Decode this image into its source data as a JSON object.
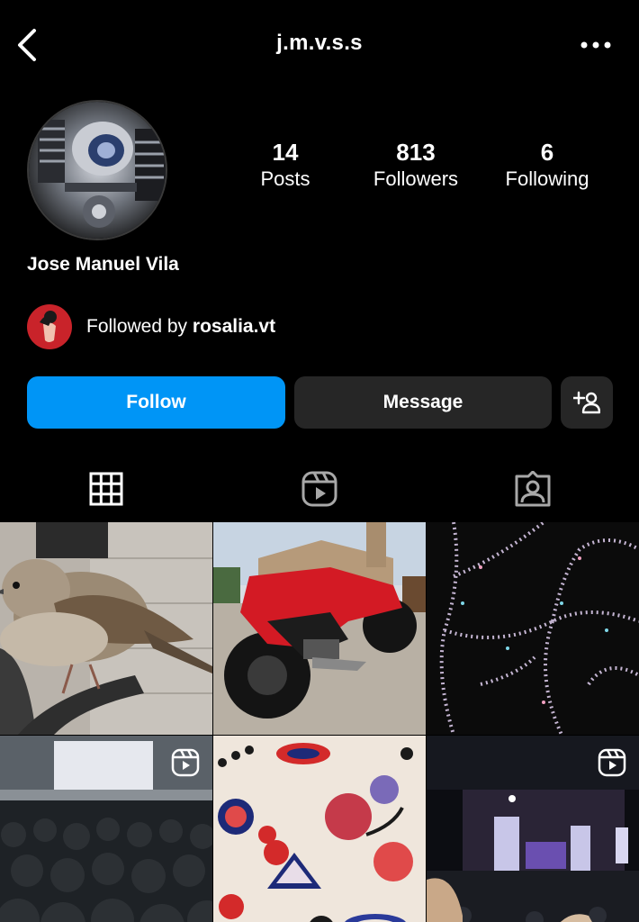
{
  "header": {
    "username": "j.m.v.s.s",
    "back_icon": "back-chevron-icon",
    "more_icon": "more-horizontal-icon"
  },
  "profile": {
    "full_name": "Jose Manuel Vila",
    "avatar_description_icon": "profile-avatar"
  },
  "stats": [
    {
      "value": "14",
      "label": "Posts"
    },
    {
      "value": "813",
      "label": "Followers"
    },
    {
      "value": "6",
      "label": "Following"
    }
  ],
  "followed_by": {
    "prefix": "Followed by ",
    "username": "rosalia.vt"
  },
  "actions": {
    "follow_label": "Follow",
    "message_label": "Message",
    "add_user_icon": "add-user-icon"
  },
  "tabs": [
    {
      "name": "posts",
      "icon": "grid-icon",
      "active": true
    },
    {
      "name": "reels",
      "icon": "reels-icon",
      "active": false
    },
    {
      "name": "tagged",
      "icon": "tagged-icon",
      "active": false
    }
  ],
  "colors": {
    "background": "#000000",
    "accent": "#0095f6",
    "secondary_button": "#262626"
  },
  "posts": [
    {
      "type": "photo",
      "reel": false
    },
    {
      "type": "photo",
      "reel": false
    },
    {
      "type": "photo",
      "reel": false
    },
    {
      "type": "reel",
      "reel": true
    },
    {
      "type": "photo",
      "reel": false
    },
    {
      "type": "reel",
      "reel": true
    }
  ]
}
